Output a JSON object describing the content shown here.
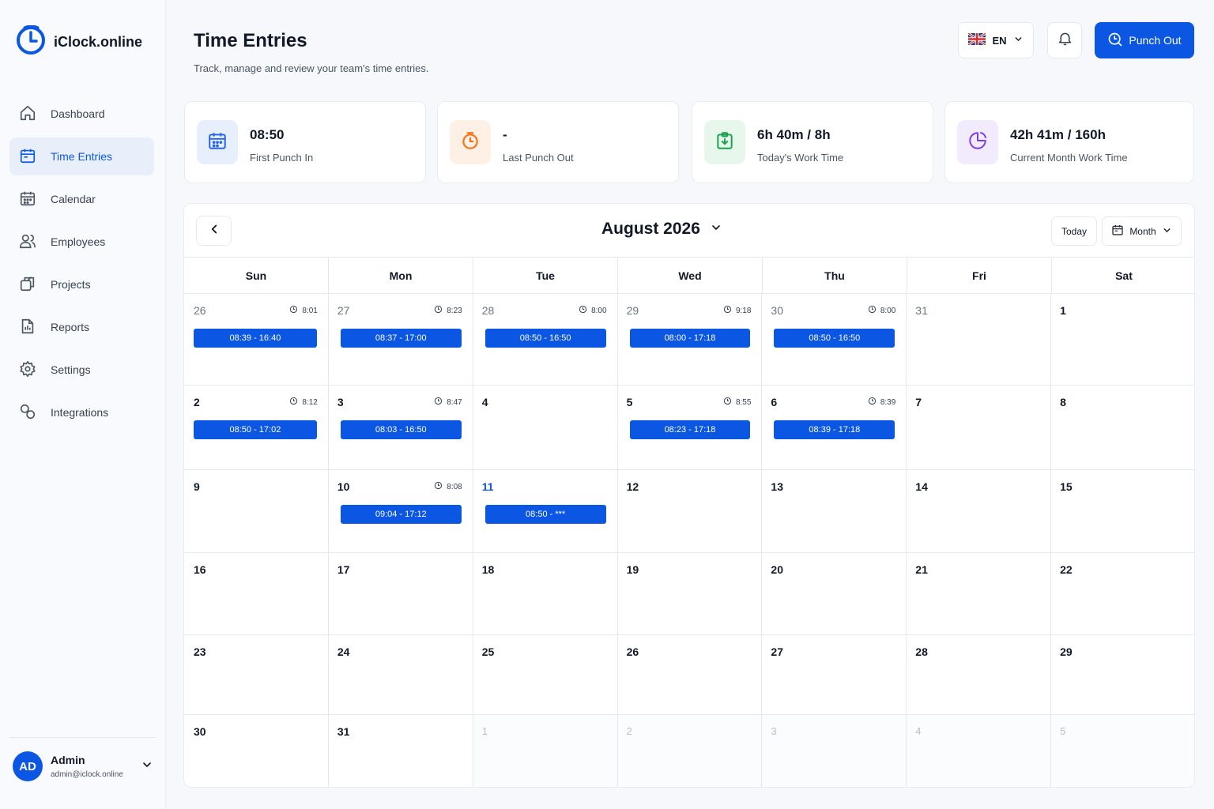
{
  "app": {
    "name": "iClock.online"
  },
  "sidebar": {
    "items": [
      {
        "label": "Dashboard",
        "icon": "home-icon",
        "active": false
      },
      {
        "label": "Time Entries",
        "icon": "calendar-clock-icon",
        "active": true
      },
      {
        "label": "Calendar",
        "icon": "calendar-icon",
        "active": false
      },
      {
        "label": "Employees",
        "icon": "users-icon",
        "active": false
      },
      {
        "label": "Projects",
        "icon": "projects-icon",
        "active": false
      },
      {
        "label": "Reports",
        "icon": "reports-icon",
        "active": false
      },
      {
        "label": "Settings",
        "icon": "gear-icon",
        "active": false
      },
      {
        "label": "Integrations",
        "icon": "integrations-icon",
        "active": false
      }
    ],
    "user": {
      "initials": "AD",
      "name": "Admin",
      "email": "admin@iclock.online"
    }
  },
  "header": {
    "title": "Time Entries",
    "subtitle": "Track, manage and review your team's time entries.",
    "language": "EN",
    "punch_label": "Punch Out"
  },
  "stats": [
    {
      "value": "08:50",
      "label": "First Punch In",
      "icon": "calendar-icon",
      "color": "#2563eb",
      "bg": "#e8effc"
    },
    {
      "value": "-",
      "label": "Last Punch Out",
      "icon": "clock-icon",
      "color": "#f97316",
      "bg": "#fff0e6"
    },
    {
      "value": "6h 40m / 8h",
      "label": "Today's Work Time",
      "icon": "clipboard-icon",
      "color": "#16a34a",
      "bg": "#e7f7ec"
    },
    {
      "value": "42h 41m / 160h",
      "label": "Current Month Work Time",
      "icon": "pie-chart-icon",
      "color": "#7c3aed",
      "bg": "#f1ebfd"
    }
  ],
  "calendar": {
    "month_label": "August 2026",
    "today_label": "Today",
    "view_label": "Month",
    "weekdays": [
      "Sun",
      "Mon",
      "Tue",
      "Wed",
      "Thu",
      "Fri",
      "Sat"
    ],
    "days": [
      {
        "day": "26",
        "kind": "prev",
        "total": "8:01",
        "entry": "08:39 - 16:40"
      },
      {
        "day": "27",
        "kind": "prev",
        "total": "8:23",
        "entry": "08:37 - 17:00"
      },
      {
        "day": "28",
        "kind": "prev",
        "total": "8:00",
        "entry": "08:50 - 16:50"
      },
      {
        "day": "29",
        "kind": "prev",
        "total": "9:18",
        "entry": "08:00 - 17:18"
      },
      {
        "day": "30",
        "kind": "prev",
        "total": "8:00",
        "entry": "08:50 - 16:50"
      },
      {
        "day": "31",
        "kind": "prev"
      },
      {
        "day": "1",
        "kind": "current"
      },
      {
        "day": "2",
        "kind": "current",
        "total": "8:12",
        "entry": "08:50 - 17:02"
      },
      {
        "day": "3",
        "kind": "current",
        "total": "8:47",
        "entry": "08:03 - 16:50"
      },
      {
        "day": "4",
        "kind": "current"
      },
      {
        "day": "5",
        "kind": "current",
        "total": "8:55",
        "entry": "08:23 - 17:18"
      },
      {
        "day": "6",
        "kind": "current",
        "total": "8:39",
        "entry": "08:39 - 17:18"
      },
      {
        "day": "7",
        "kind": "current"
      },
      {
        "day": "8",
        "kind": "current"
      },
      {
        "day": "9",
        "kind": "current"
      },
      {
        "day": "10",
        "kind": "current",
        "total": "8:08",
        "entry": "09:04 - 17:12"
      },
      {
        "day": "11",
        "kind": "today",
        "entry": "08:50 - ***"
      },
      {
        "day": "12",
        "kind": "current"
      },
      {
        "day": "13",
        "kind": "current"
      },
      {
        "day": "14",
        "kind": "current"
      },
      {
        "day": "15",
        "kind": "current"
      },
      {
        "day": "16",
        "kind": "current"
      },
      {
        "day": "17",
        "kind": "current"
      },
      {
        "day": "18",
        "kind": "current"
      },
      {
        "day": "19",
        "kind": "current"
      },
      {
        "day": "20",
        "kind": "current"
      },
      {
        "day": "21",
        "kind": "current"
      },
      {
        "day": "22",
        "kind": "current"
      },
      {
        "day": "23",
        "kind": "current"
      },
      {
        "day": "24",
        "kind": "current"
      },
      {
        "day": "25",
        "kind": "current"
      },
      {
        "day": "26",
        "kind": "current"
      },
      {
        "day": "27",
        "kind": "current"
      },
      {
        "day": "28",
        "kind": "current"
      },
      {
        "day": "29",
        "kind": "current"
      },
      {
        "day": "30",
        "kind": "current"
      },
      {
        "day": "31",
        "kind": "current"
      },
      {
        "day": "1",
        "kind": "next"
      },
      {
        "day": "2",
        "kind": "next"
      },
      {
        "day": "3",
        "kind": "next"
      },
      {
        "day": "4",
        "kind": "next"
      },
      {
        "day": "5",
        "kind": "next"
      }
    ]
  },
  "colors": {
    "accent": "#0b57e3",
    "border": "#e5e9ef",
    "text": "#111827",
    "muted": "#4b5563"
  }
}
